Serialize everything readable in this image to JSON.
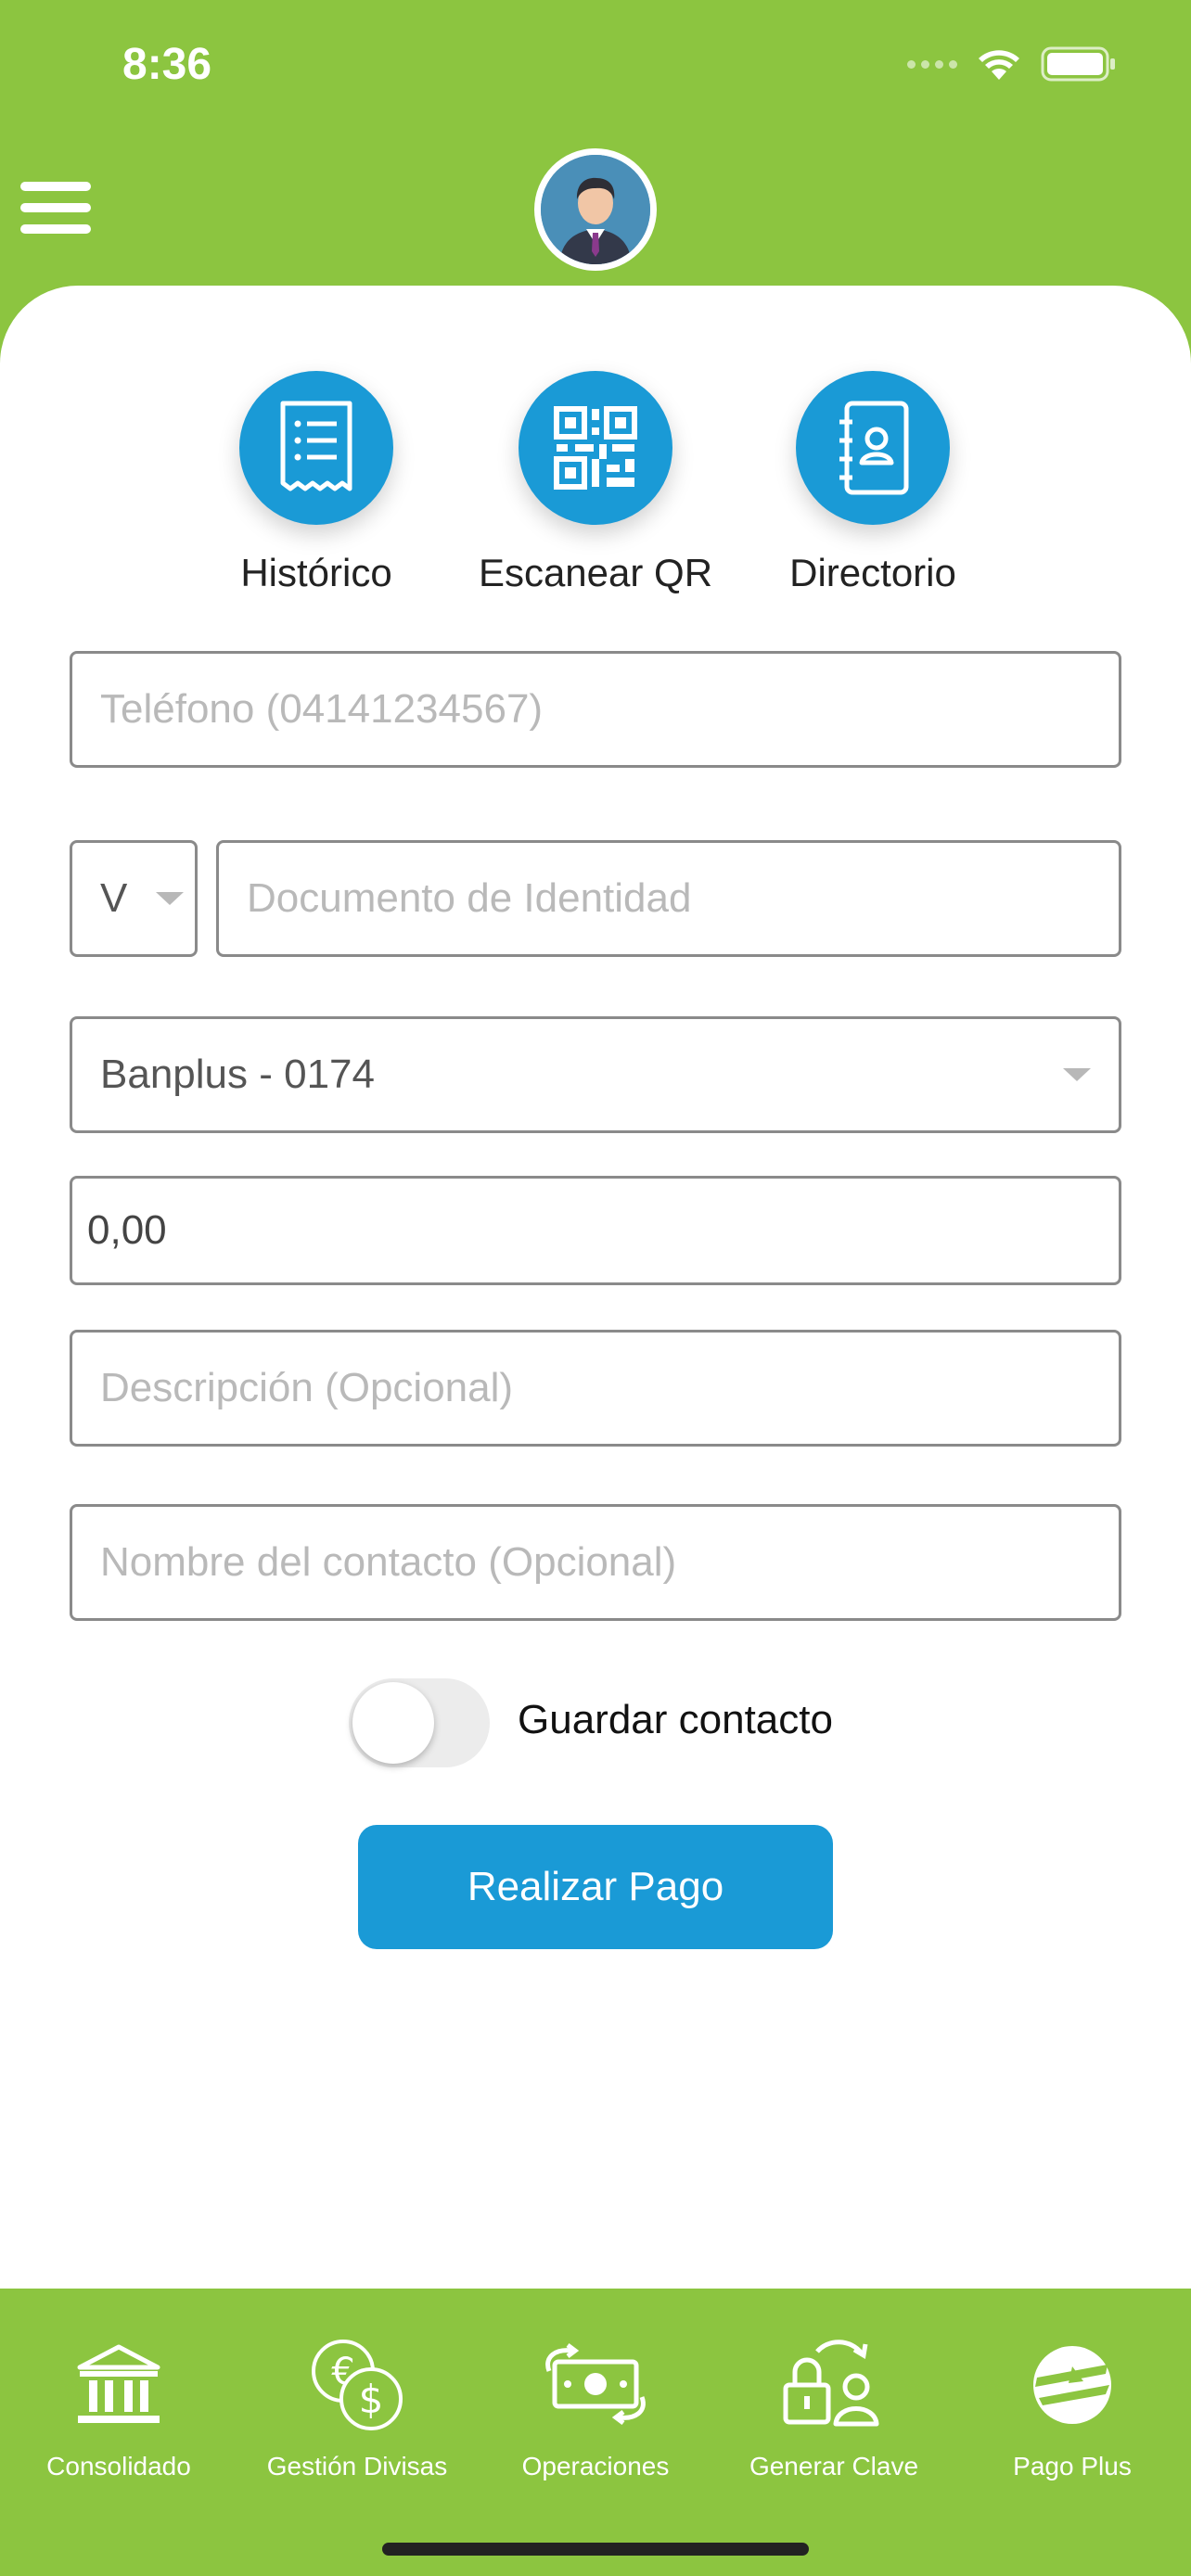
{
  "status_bar": {
    "time": "8:36"
  },
  "quick_actions": [
    {
      "label": "Histórico",
      "icon": "receipt-list-icon"
    },
    {
      "label": "Escanear QR",
      "icon": "qr-code-icon"
    },
    {
      "label": "Directorio",
      "icon": "contacts-book-icon"
    }
  ],
  "form": {
    "phone_placeholder": "Teléfono (04141234567)",
    "id_type_value": "V",
    "id_placeholder": "Documento de Identidad",
    "bank_value": "Banplus - 0174",
    "amount_value": "0,00",
    "description_placeholder": "Descripción (Opcional)",
    "contact_name_placeholder": "Nombre del contacto (Opcional)",
    "save_contact_label": "Guardar contacto",
    "submit_label": "Realizar Pago"
  },
  "bottom_nav": [
    {
      "label": "Consolidado",
      "icon": "bank-icon"
    },
    {
      "label": "Gestión Divisas",
      "icon": "currency-exchange-icon"
    },
    {
      "label": "Operaciones",
      "icon": "cash-transfer-icon"
    },
    {
      "label": "Generar Clave",
      "icon": "lock-user-icon"
    },
    {
      "label": "Pago Plus",
      "icon": "pago-plus-icon"
    }
  ],
  "colors": {
    "brand_green": "#8cc540",
    "primary_blue": "#1a9ad6"
  }
}
